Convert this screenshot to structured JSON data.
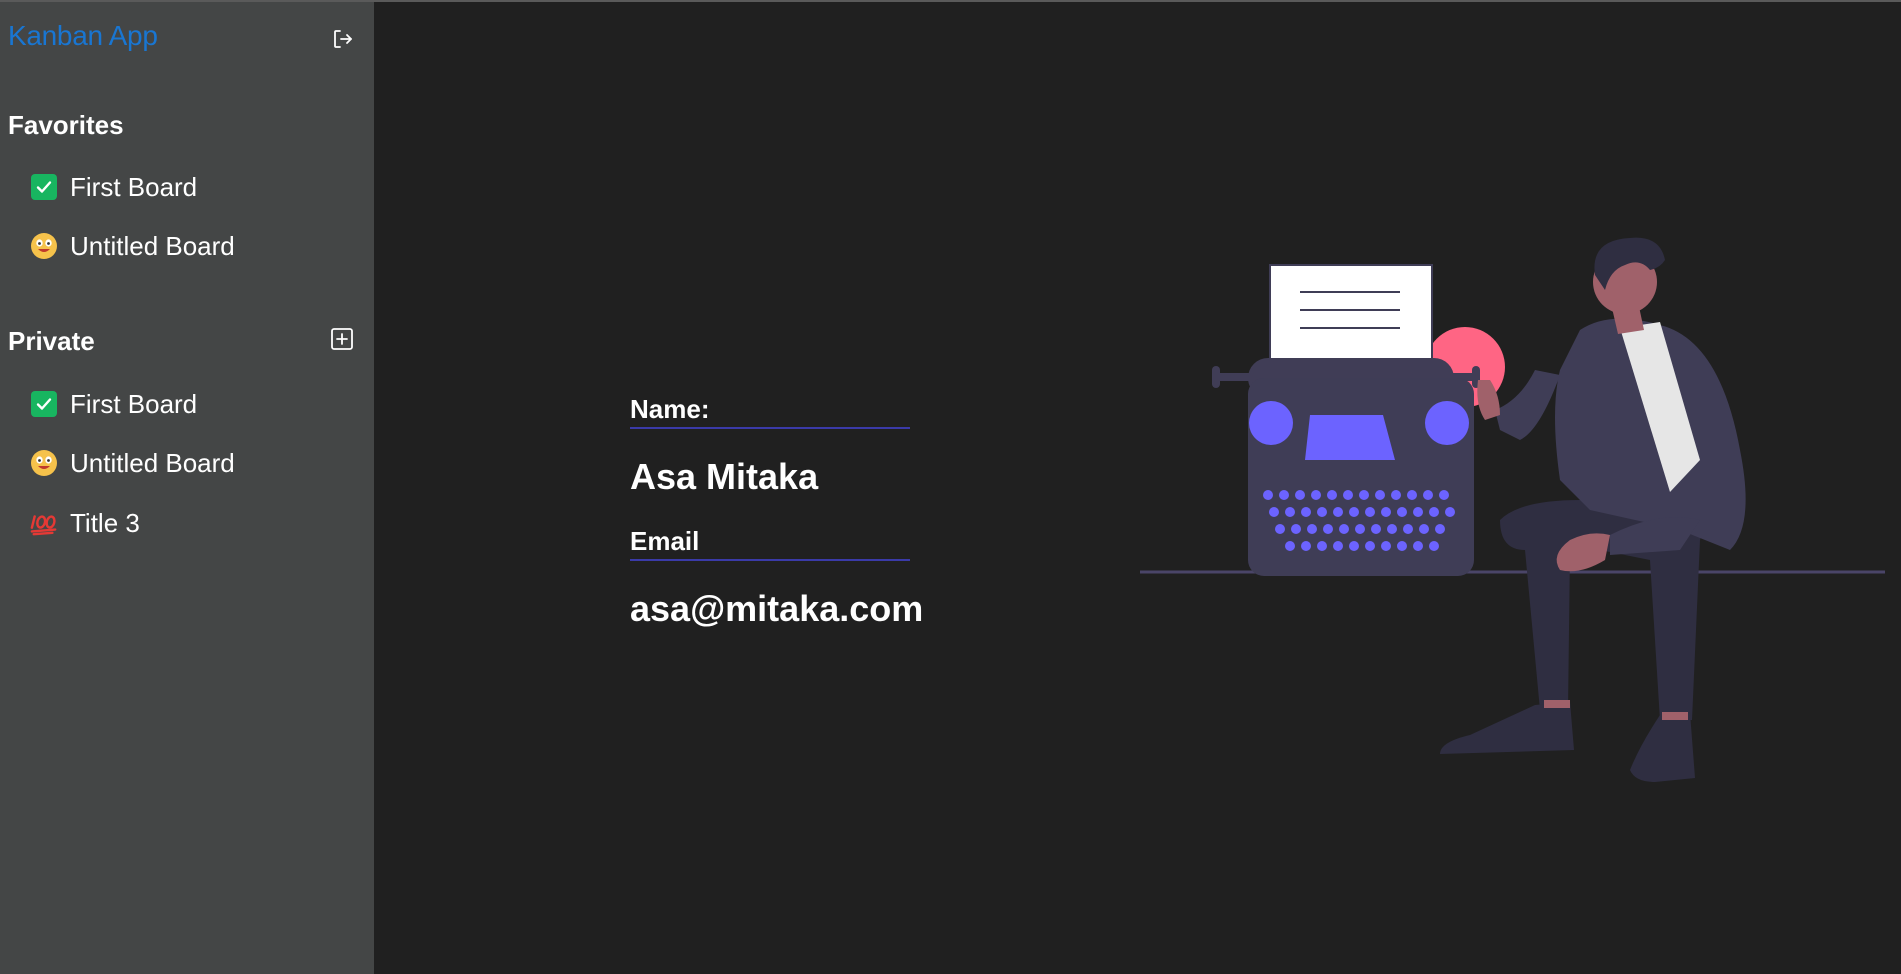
{
  "app": {
    "title": "Kanban App"
  },
  "sidebar": {
    "logout_icon": "logout-icon",
    "favorites": {
      "title": "Favorites",
      "items": [
        {
          "icon": "check-mark-button-emoji",
          "label": "First Board"
        },
        {
          "icon": "grinning-face-emoji",
          "label": "Untitled Board"
        }
      ]
    },
    "private": {
      "title": "Private",
      "add_icon": "add-box-icon",
      "items": [
        {
          "icon": "check-mark-button-emoji",
          "label": "First Board"
        },
        {
          "icon": "grinning-face-emoji",
          "label": "Untitled Board"
        },
        {
          "icon": "hundred-points-emoji",
          "label": "Title 3"
        }
      ]
    }
  },
  "profile": {
    "name_label": "Name:",
    "name_value": "Asa Mitaka",
    "email_label": "Email",
    "email_value": "asa@mitaka.com"
  },
  "illustration": {
    "icon": "typewriter-person-illustration"
  },
  "colors": {
    "sidebar_bg": "#444646",
    "main_bg": "#202020",
    "brand": "#1976d2",
    "accent_underline": "#3a3aa8",
    "illustration_purple": "#6c63ff",
    "illustration_pink": "#ff6584"
  }
}
